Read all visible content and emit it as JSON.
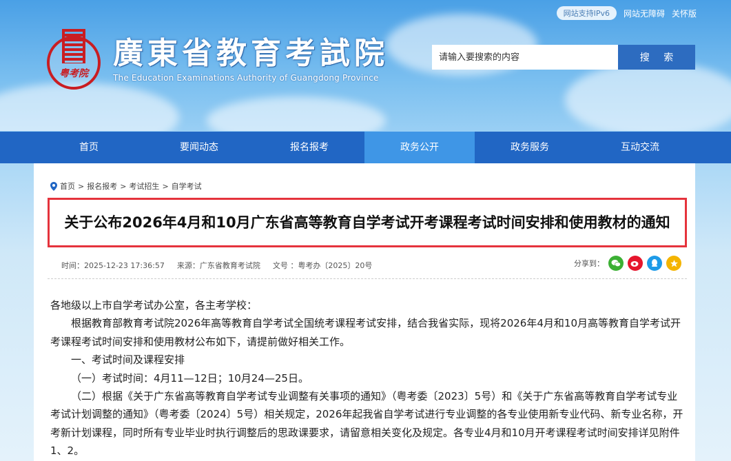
{
  "header": {
    "ipv6_badge": "网站支持IPv6",
    "accessible_link": "网站无障碍",
    "care_link": "关怀版",
    "seal_text": "粤考院",
    "logo_cn": "廣東省教育考試院",
    "logo_en": "The Education Examinations Authority of Guangdong Province",
    "search_placeholder": "请输入要搜索的内容",
    "search_button": "搜 索"
  },
  "nav": {
    "items": [
      {
        "label": "首页",
        "active": false
      },
      {
        "label": "要闻动态",
        "active": false
      },
      {
        "label": "报名报考",
        "active": false
      },
      {
        "label": "政务公开",
        "active": true
      },
      {
        "label": "政务服务",
        "active": false
      },
      {
        "label": "互动交流",
        "active": false
      }
    ]
  },
  "breadcrumb": [
    "首页",
    "报名报考",
    "考试招生",
    "自学考试"
  ],
  "article": {
    "title": "关于公布2026年4月和10月广东省高等教育自学考试开考课程考试时间安排和使用教材的通知",
    "meta_time": "时间：2025-12-23 17:36:57",
    "meta_source": "来源：广东省教育考试院",
    "meta_docno": "文号 ：粤考办〔2025〕20号",
    "share_label": "分享到：",
    "paragraphs": [
      "各地级以上市自学考试办公室，各主考学校：",
      "根据教育部教育考试院2026年高等教育自学考试全国统考课程考试安排，结合我省实际，现将2026年4月和10月高等教育自学考试开考课程考试时间安排和使用教材公布如下，请提前做好相关工作。",
      "一、考试时间及课程安排",
      "（一）考试时间：4月11—12日；10月24—25日。",
      "（二）根据《关于广东省高等教育自学考试专业调整有关事项的通知》（粤考委〔2023〕5号）和《关于广东省高等教育自学考试专业考试计划调整的通知》（粤考委〔2024〕5号）相关规定，2026年起我省自学考试进行专业调整的各专业使用新专业代码、新专业名称，开考新计划课程，同时所有专业毕业时执行调整后的思政课要求，请留意相关变化及规定。各专业4月和10月开考课程考试时间安排详见附件1、2。"
    ]
  },
  "colors": {
    "nav_bg": "#2166c4",
    "nav_active": "#3f96e6",
    "search_btn": "#2d6cc0",
    "title_border": "#e5333c",
    "seal_red": "#c91d22"
  },
  "share_icons": [
    {
      "name": "wechat-icon",
      "color": "#3cb034",
      "glyph": "◉"
    },
    {
      "name": "weibo-icon",
      "color": "#e6162d",
      "glyph": "◉"
    },
    {
      "name": "qq-icon",
      "color": "#1e9be8",
      "glyph": "◉"
    },
    {
      "name": "qzone-icon",
      "color": "#f4b400",
      "glyph": "★"
    }
  ]
}
